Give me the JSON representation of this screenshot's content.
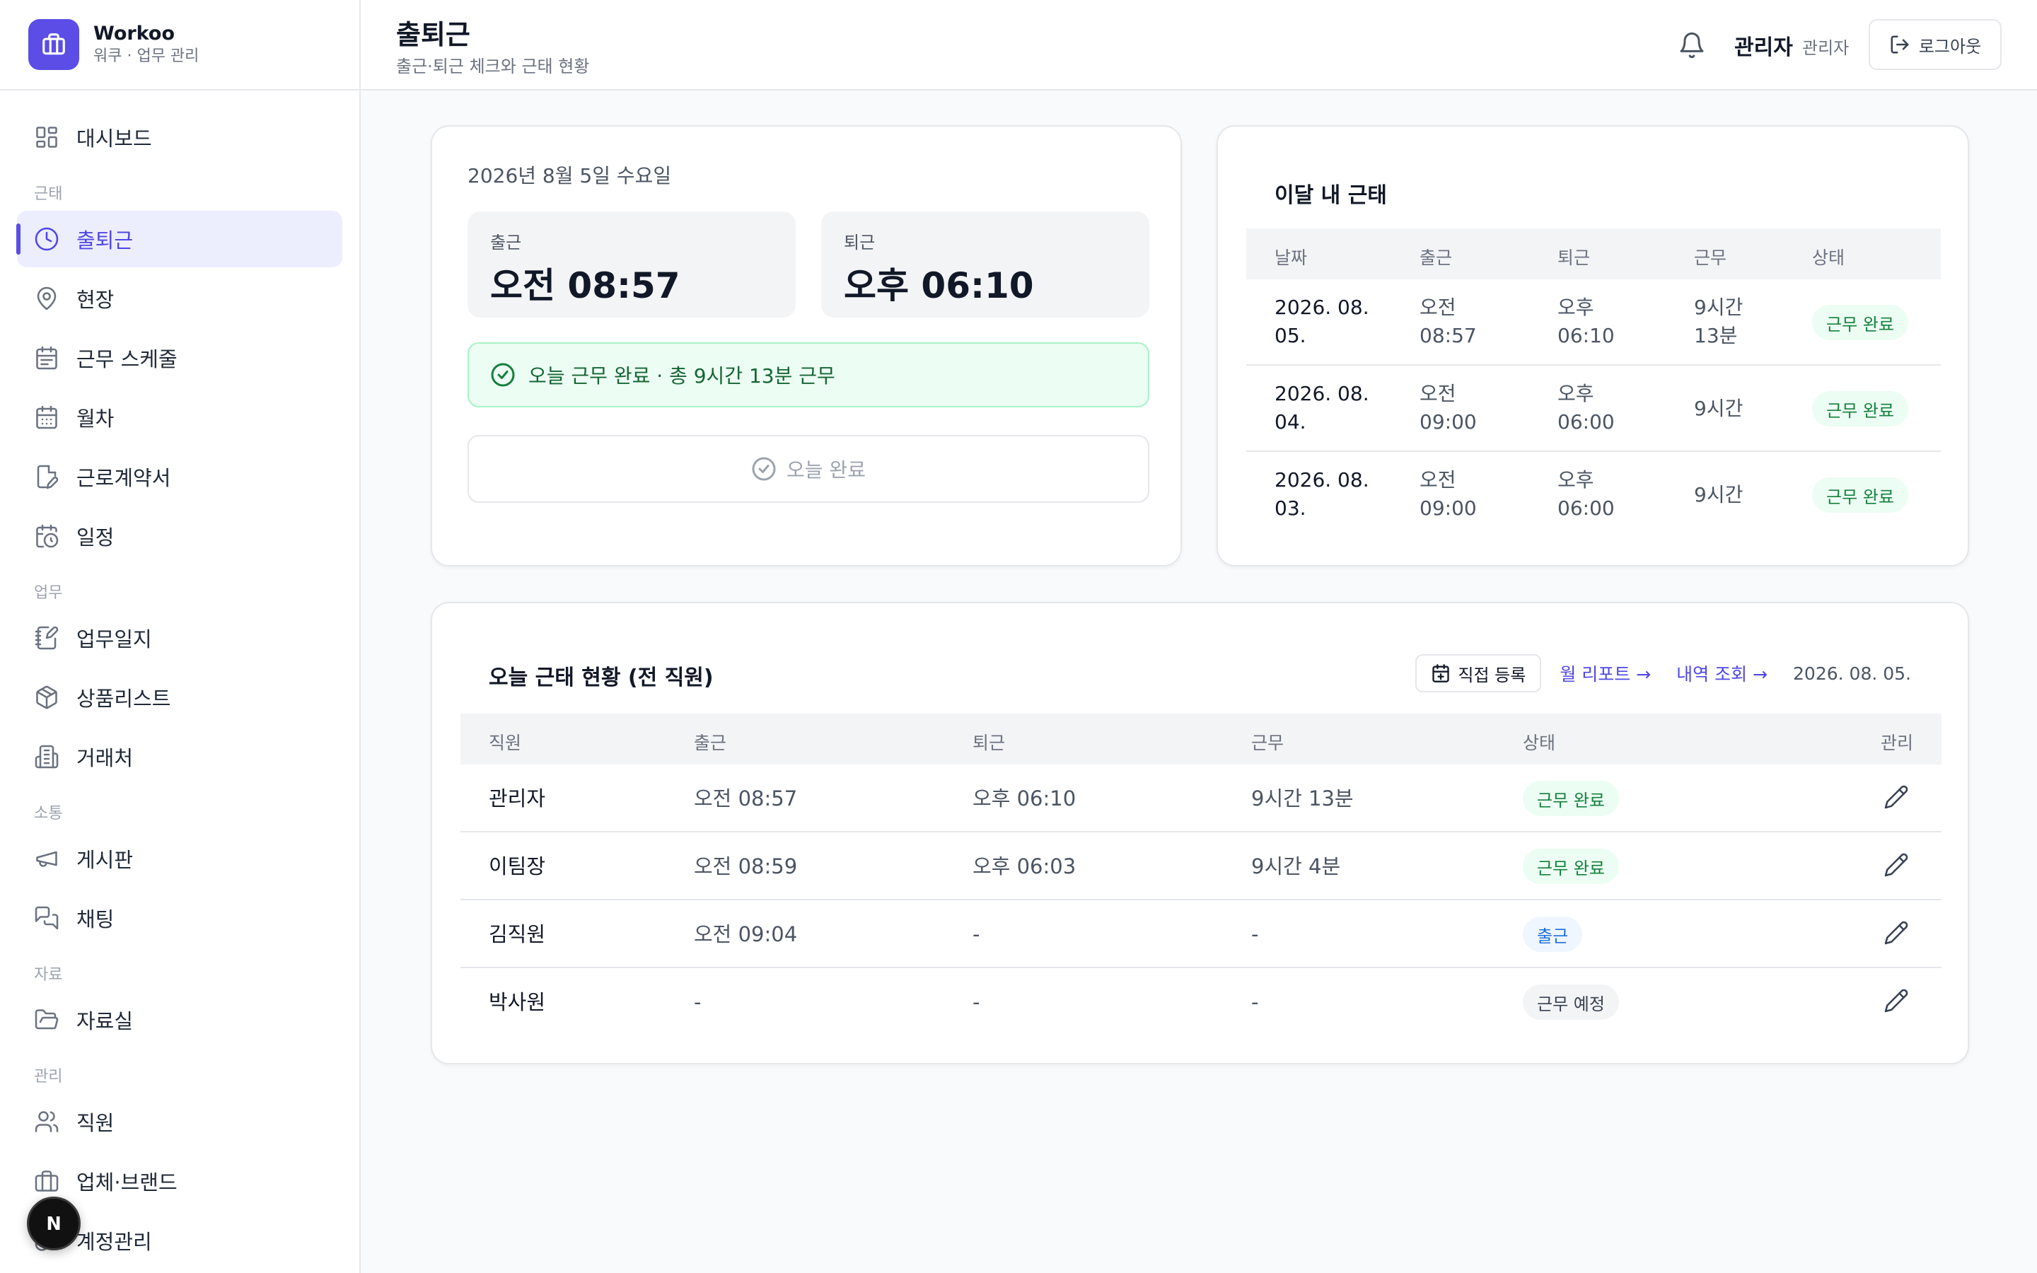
{
  "brand": {
    "name": "Workoo",
    "subtitle": "워쿠 · 업무 관리"
  },
  "sidebar": {
    "items": [
      {
        "type": "item",
        "label": "대시보드",
        "icon": "grid-icon"
      },
      {
        "type": "section",
        "label": "근태"
      },
      {
        "type": "item",
        "label": "출퇴근",
        "icon": "clock-icon",
        "active": true
      },
      {
        "type": "item",
        "label": "현장",
        "icon": "map-pin-icon"
      },
      {
        "type": "item",
        "label": "근무 스케줄",
        "icon": "calendar-list-icon"
      },
      {
        "type": "item",
        "label": "월차",
        "icon": "calendar-icon"
      },
      {
        "type": "item",
        "label": "근로계약서",
        "icon": "file-edit-icon"
      },
      {
        "type": "item",
        "label": "일정",
        "icon": "calendar-clock-icon"
      },
      {
        "type": "section",
        "label": "업무"
      },
      {
        "type": "item",
        "label": "업무일지",
        "icon": "notebook-pen-icon"
      },
      {
        "type": "item",
        "label": "상품리스트",
        "icon": "package-icon"
      },
      {
        "type": "item",
        "label": "거래처",
        "icon": "building-icon"
      },
      {
        "type": "section",
        "label": "소통"
      },
      {
        "type": "item",
        "label": "게시판",
        "icon": "megaphone-icon"
      },
      {
        "type": "item",
        "label": "채팅",
        "icon": "chat-icon"
      },
      {
        "type": "section",
        "label": "자료"
      },
      {
        "type": "item",
        "label": "자료실",
        "icon": "folder-icon"
      },
      {
        "type": "section",
        "label": "관리"
      },
      {
        "type": "item",
        "label": "직원",
        "icon": "users-icon"
      },
      {
        "type": "item",
        "label": "업체·브랜드",
        "icon": "briefcase-icon"
      },
      {
        "type": "item",
        "label": "계정관리",
        "icon": "key-icon"
      }
    ],
    "fab_letter": "N"
  },
  "header": {
    "title": "출퇴근",
    "subtitle": "출근·퇴근 체크와 근태 현황",
    "user_name": "관리자",
    "user_role": "관리자",
    "logout_label": "로그아웃"
  },
  "checkin": {
    "date": "2026년 8월 5일 수요일",
    "in_label": "출근",
    "in_time": "오전 08:57",
    "out_label": "퇴근",
    "out_time": "오후 06:10",
    "banner": "오늘 근무 완료 · 총 9시간 13분 근무",
    "done_button": "오늘 완료"
  },
  "monthly": {
    "title": "이달 내 근태",
    "columns": [
      "날짜",
      "출근",
      "퇴근",
      "근무",
      "상태"
    ],
    "rows": [
      {
        "date": [
          "2026. 08.",
          "05."
        ],
        "in": [
          "오전",
          "08:57"
        ],
        "out": [
          "오후",
          "06:10"
        ],
        "work": [
          "9시간",
          "13분"
        ],
        "status": "근무 완료"
      },
      {
        "date": [
          "2026. 08.",
          "04."
        ],
        "in": [
          "오전",
          "09:00"
        ],
        "out": [
          "오후",
          "06:00"
        ],
        "work": [
          "9시간"
        ],
        "status": "근무 완료"
      },
      {
        "date": [
          "2026. 08.",
          "03."
        ],
        "in": [
          "오전",
          "09:00"
        ],
        "out": [
          "오후",
          "06:00"
        ],
        "work": [
          "9시간"
        ],
        "status": "근무 완료"
      }
    ]
  },
  "today": {
    "title": "오늘 근태 현황 (전 직원)",
    "register_label": "직접 등록",
    "report_link": "월 리포트 →",
    "history_link": "내역 조회 →",
    "date": "2026. 08. 05.",
    "columns": [
      "직원",
      "출근",
      "퇴근",
      "근무",
      "상태",
      "관리"
    ],
    "rows": [
      {
        "name": "관리자",
        "in": "오전 08:57",
        "out": "오후 06:10",
        "work": "9시간 13분",
        "status": "근무 완료",
        "tone": "green"
      },
      {
        "name": "이팀장",
        "in": "오전 08:59",
        "out": "오후 06:03",
        "work": "9시간 4분",
        "status": "근무 완료",
        "tone": "green"
      },
      {
        "name": "김직원",
        "in": "오전 09:04",
        "out": "-",
        "work": "-",
        "status": "출근",
        "tone": "blue"
      },
      {
        "name": "박사원",
        "in": "-",
        "out": "-",
        "work": "-",
        "status": "근무 예정",
        "tone": "gray"
      }
    ]
  },
  "colors": {
    "accent": "#5b4de6",
    "success": "#15803d",
    "info": "#1d6fd8"
  }
}
